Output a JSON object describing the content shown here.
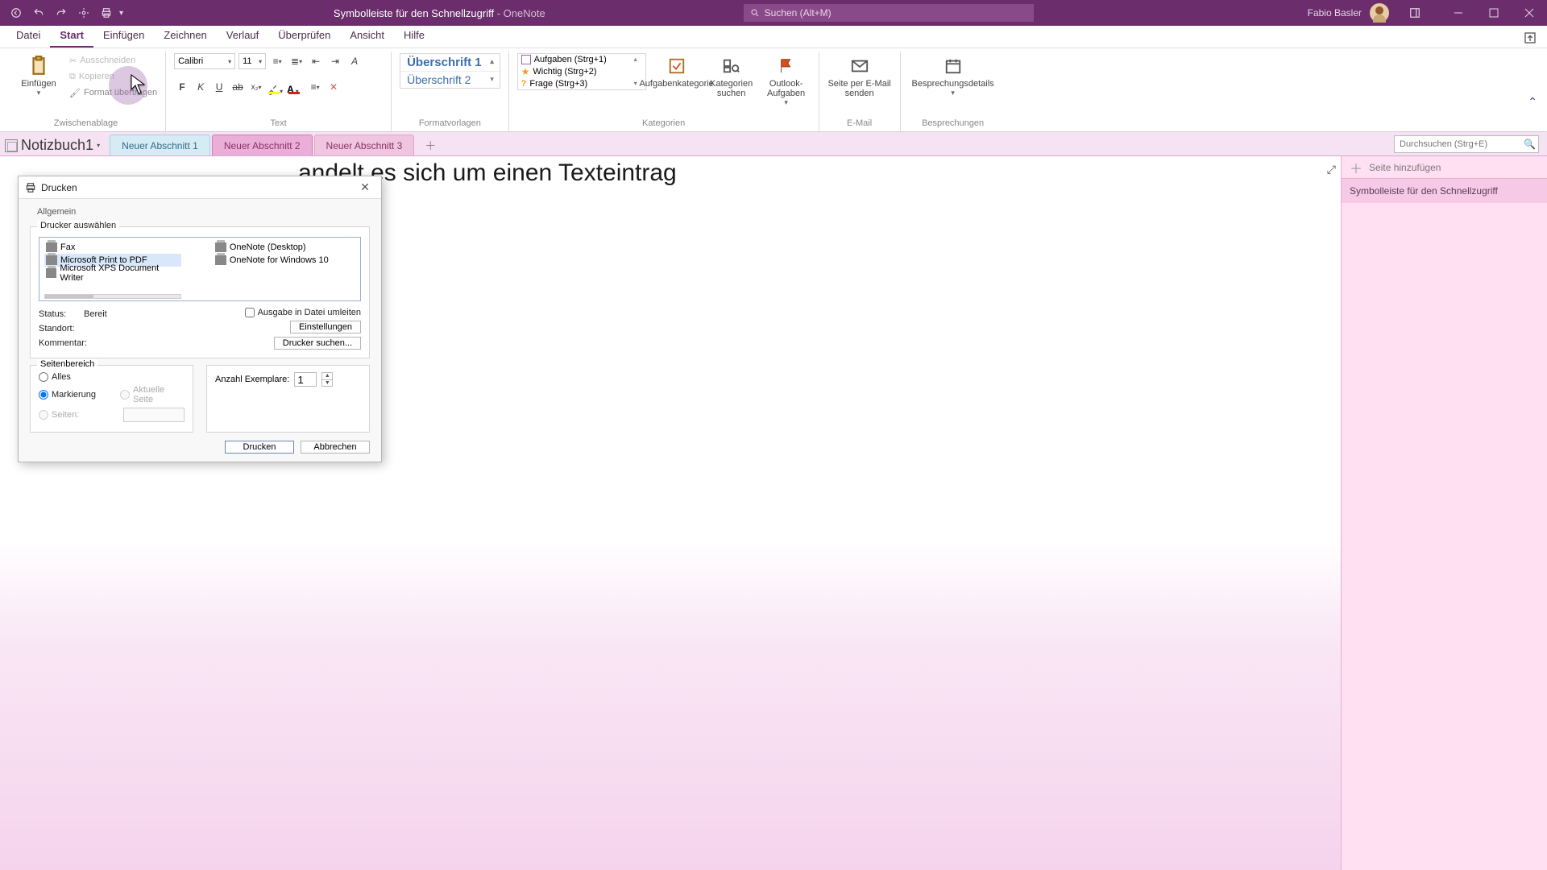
{
  "titlebar": {
    "doc_title": "Symbolleiste für den Schnellzugriff",
    "separator": " - ",
    "app": "OneNote",
    "search_placeholder": "Suchen (Alt+M)",
    "user": "Fabio Basler"
  },
  "ribbon_tabs": {
    "datei": "Datei",
    "start": "Start",
    "einfuegen": "Einfügen",
    "zeichnen": "Zeichnen",
    "verlauf": "Verlauf",
    "ueberpruefen": "Überprüfen",
    "ansicht": "Ansicht",
    "hilfe": "Hilfe"
  },
  "ribbon": {
    "paste": "Einfügen",
    "cut": "Ausschneiden",
    "copy": "Kopieren",
    "format_painter": "Format übertragen",
    "grp_clipboard": "Zwischenablage",
    "font_name": "Calibri",
    "font_size": "11",
    "grp_text": "Text",
    "style_h1": "Überschrift 1",
    "style_h2": "Überschrift 2",
    "grp_styles": "Formatvorlagen",
    "tag_todo": "Aufgaben (Strg+1)",
    "tag_important": "Wichtig (Strg+2)",
    "tag_question": "Frage (Strg+3)",
    "tag_btn": "Aufgabenkategorie",
    "tag_find": "Kategorien suchen",
    "outlook_tasks": "Outlook-Aufgaben",
    "grp_tags": "Kategorien",
    "email_page": "Seite per E-Mail senden",
    "grp_email": "E-Mail",
    "meeting_details": "Besprechungsdetails",
    "grp_meetings": "Besprechungen"
  },
  "notebook": {
    "name": "Notizbuch1",
    "section1": "Neuer Abschnitt 1",
    "section2": "Neuer Abschnitt 2",
    "section3": "Neuer Abschnitt 3",
    "search_ph": "Durchsuchen (Strg+E)"
  },
  "page": {
    "visible_text": "andelt es sich um einen Texteintrag",
    "add_page": "Seite hinzufügen",
    "page1": "Symbolleiste für den Schnellzugriff"
  },
  "print": {
    "title": "Drucken",
    "tab_general": "Allgemein",
    "select_printer": "Drucker auswählen",
    "p_fax": "Fax",
    "p_mpdf": "Microsoft Print to PDF",
    "p_mxps": "Microsoft XPS Document Writer",
    "p_ond": "OneNote (Desktop)",
    "p_onw": "OneNote for Windows 10",
    "status_lbl": "Status:",
    "status_val": "Bereit",
    "location_lbl": "Standort:",
    "comment_lbl": "Kommentar:",
    "to_file": "Ausgabe in Datei umleiten",
    "settings_btn": "Einstellungen",
    "find_printer_btn": "Drucker suchen...",
    "range_legend": "Seitenbereich",
    "range_all": "Alles",
    "range_sel": "Markierung",
    "range_cur": "Aktuelle Seite",
    "range_pages": "Seiten:",
    "copies_lbl": "Anzahl Exemplare:",
    "copies_val": "1",
    "btn_print": "Drucken",
    "btn_cancel": "Abbrechen"
  }
}
